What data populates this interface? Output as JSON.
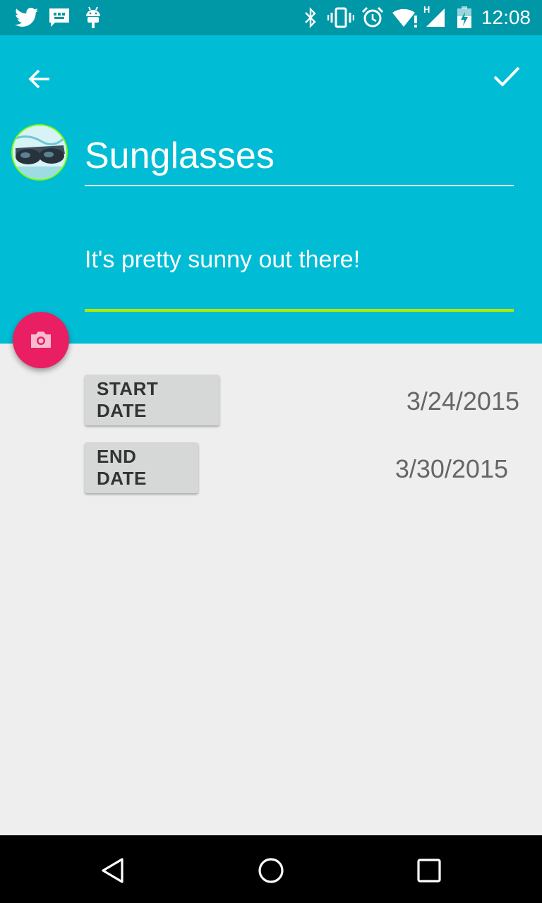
{
  "status_bar": {
    "time": "12:08",
    "left_icons": [
      "twitter-icon",
      "message-icon",
      "android-icon"
    ],
    "right_icons": [
      "bluetooth-icon",
      "vibrate-icon",
      "alarm-icon",
      "wifi-icon",
      "signal-icon",
      "battery-icon"
    ],
    "signal_label": "H"
  },
  "header": {
    "title": "Sunglasses",
    "description": "It's pretty sunny out there!",
    "colors": {
      "primary": "#00bcd4",
      "primary_dark": "#0097a7",
      "accent_underline": "#aeea00",
      "fab": "#e91e63"
    }
  },
  "dates": {
    "start_label": "START DATE",
    "start_value": "3/24/2015",
    "end_label": "END DATE",
    "end_value": "3/30/2015"
  },
  "nav": {
    "buttons": [
      "back-nav-icon",
      "home-nav-icon",
      "recents-nav-icon"
    ]
  }
}
